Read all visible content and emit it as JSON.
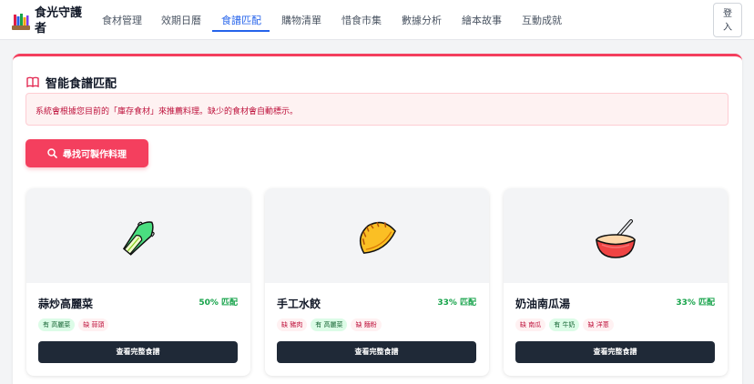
{
  "app": {
    "title": "食光守護者"
  },
  "nav": {
    "items": [
      {
        "label": "食材管理"
      },
      {
        "label": "效期日曆"
      },
      {
        "label": "食譜匹配"
      },
      {
        "label": "購物清單"
      },
      {
        "label": "惜食市集"
      },
      {
        "label": "數據分析"
      },
      {
        "label": "繪本故事"
      },
      {
        "label": "互動成就"
      }
    ],
    "active_index": 2,
    "login_label": "登入"
  },
  "panel": {
    "title": "智能食譜匹配",
    "info": "系統會根據您目前的「庫存食材」來推薦料理。缺少的食材會自動標示。",
    "find_button": "尋找可製作料理"
  },
  "cards": [
    {
      "emoji_icon": "bok-choy-icon",
      "name": "蒜炒高麗菜",
      "match": "50% 匹配",
      "tags": [
        {
          "label": "有 高麗菜",
          "status": "have"
        },
        {
          "label": "缺 蒜頭",
          "status": "miss"
        }
      ],
      "button": "查看完整食譜"
    },
    {
      "emoji_icon": "dumpling-icon",
      "name": "手工水餃",
      "match": "33% 匹配",
      "tags": [
        {
          "label": "缺 豬肉",
          "status": "miss"
        },
        {
          "label": "有 高麗菜",
          "status": "have"
        },
        {
          "label": "缺 麵粉",
          "status": "miss"
        }
      ],
      "button": "查看完整食譜"
    },
    {
      "emoji_icon": "soup-bowl-icon",
      "name": "奶油南瓜湯",
      "match": "33% 匹配",
      "tags": [
        {
          "label": "缺 南瓜",
          "status": "miss"
        },
        {
          "label": "有 牛奶",
          "status": "have"
        },
        {
          "label": "缺 洋蔥",
          "status": "miss"
        }
      ],
      "button": "查看完整食譜"
    }
  ],
  "colors": {
    "accent": "#f43f5e",
    "nav_active": "#2563eb",
    "match_green": "#16a34a",
    "dark_button": "#1f2937"
  }
}
